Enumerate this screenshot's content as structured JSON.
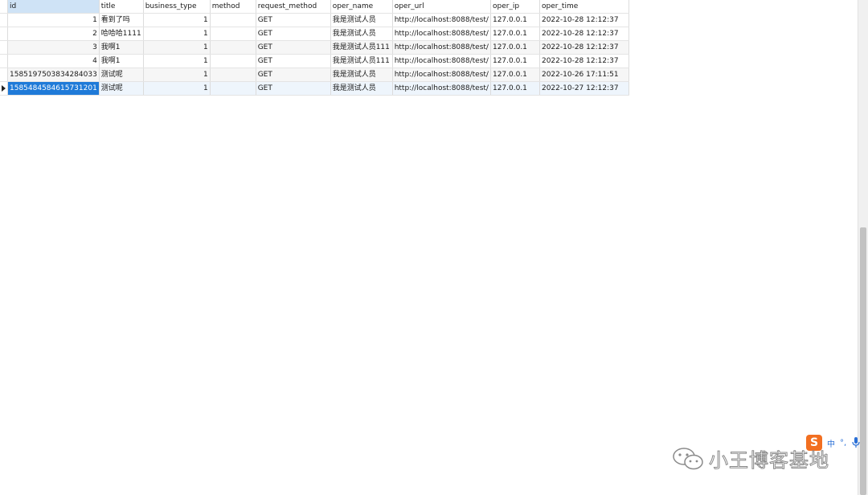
{
  "columns": [
    "id",
    "title",
    "business_type",
    "method",
    "request_method",
    "oper_name",
    "oper_url",
    "oper_ip",
    "oper_time"
  ],
  "rows": [
    {
      "id": "1",
      "title": "看到了吗",
      "business_type": "1",
      "method": "",
      "request_method": "GET",
      "oper_name": "我是测试人员",
      "oper_url": "http://localhost:8088/test/",
      "oper_ip": "127.0.0.1",
      "oper_time": "2022-10-28 12:12:37"
    },
    {
      "id": "2",
      "title": "哈哈哈1111",
      "business_type": "1",
      "method": "",
      "request_method": "GET",
      "oper_name": "我是测试人员",
      "oper_url": "http://localhost:8088/test/",
      "oper_ip": "127.0.0.1",
      "oper_time": "2022-10-28 12:12:37"
    },
    {
      "id": "3",
      "title": "我啊1",
      "business_type": "1",
      "method": "",
      "request_method": "GET",
      "oper_name": "我是测试人员111",
      "oper_url": "http://localhost:8088/test/",
      "oper_ip": "127.0.0.1",
      "oper_time": "2022-10-28 12:12:37"
    },
    {
      "id": "4",
      "title": "我啊1",
      "business_type": "1",
      "method": "",
      "request_method": "GET",
      "oper_name": "我是测试人员111",
      "oper_url": "http://localhost:8088/test/",
      "oper_ip": "127.0.0.1",
      "oper_time": "2022-10-28 12:12:37"
    },
    {
      "id": "1585197503834284033",
      "title": "测试呢",
      "business_type": "1",
      "method": "",
      "request_method": "GET",
      "oper_name": "我是测试人员",
      "oper_url": "http://localhost:8088/test/",
      "oper_ip": "127.0.0.1",
      "oper_time": "2022-10-26 17:11:51"
    },
    {
      "id": "1585484584615731201",
      "title": "测试呢",
      "business_type": "1",
      "method": "",
      "request_method": "GET",
      "oper_name": "我是测试人员",
      "oper_url": "http://localhost:8088/test/",
      "oper_ip": "127.0.0.1",
      "oper_time": "2022-10-27 12:12:37"
    }
  ],
  "selected_row_index": 5,
  "selected_column": "id",
  "colors": {
    "header_active": "#cfe3f6",
    "selection": "#1f7ad8",
    "current_row": "#eef5fc",
    "stripe": "#f6f6f6",
    "ime_logo": "#f26f21",
    "ime_accent": "#2a6fd6"
  },
  "scrollbar": {
    "visible_fraction": 0.54,
    "position_fraction": 0.46
  },
  "ime": {
    "logo": "S",
    "mode": "中",
    "punct": "°,",
    "icons": [
      "sogou-logo-icon",
      "microphone-icon"
    ]
  },
  "watermark": {
    "text": "小王博客基地",
    "icon": "wechat-icon"
  }
}
